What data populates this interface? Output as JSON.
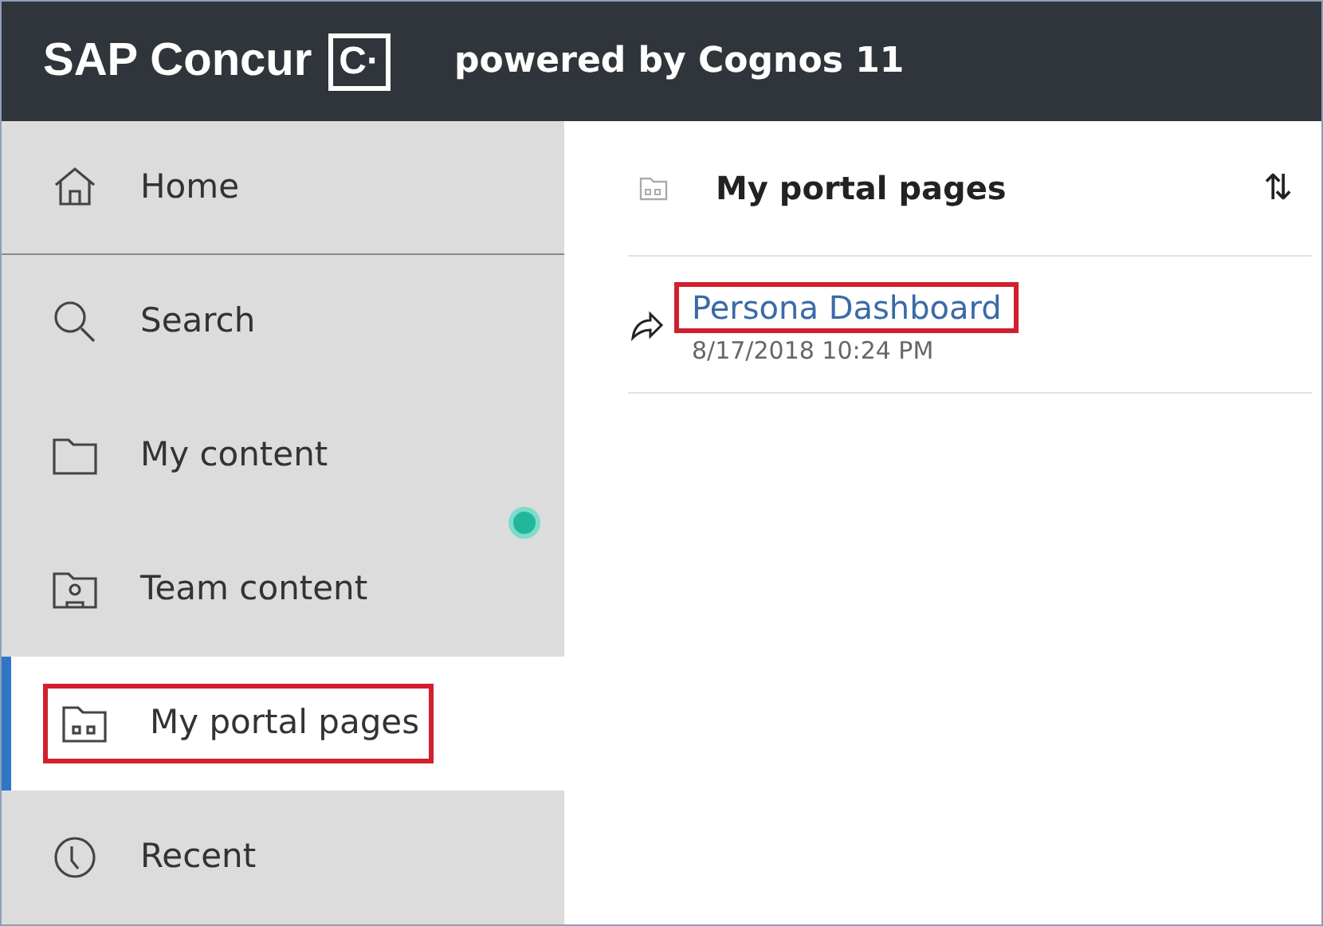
{
  "header": {
    "brand": "SAP Concur",
    "logo_letter": "C·",
    "subtitle": "powered by Cognos 11"
  },
  "sidebar": {
    "items": [
      {
        "kind": "home",
        "label": "Home",
        "selected": false,
        "highlighted": false
      },
      {
        "kind": "search",
        "label": "Search",
        "selected": false,
        "highlighted": false
      },
      {
        "kind": "folder",
        "label": "My content",
        "selected": false,
        "highlighted": false
      },
      {
        "kind": "team",
        "label": "Team content",
        "selected": false,
        "highlighted": false
      },
      {
        "kind": "portal",
        "label": "My portal pages",
        "selected": true,
        "highlighted": true
      },
      {
        "kind": "recent",
        "label": "Recent",
        "selected": false,
        "highlighted": false
      }
    ]
  },
  "panel": {
    "title": "My portal pages",
    "sort_icon": "⇅",
    "items": [
      {
        "name": "Persona Dashboard",
        "date": "8/17/2018 10:24 PM",
        "highlighted": true
      }
    ]
  }
}
